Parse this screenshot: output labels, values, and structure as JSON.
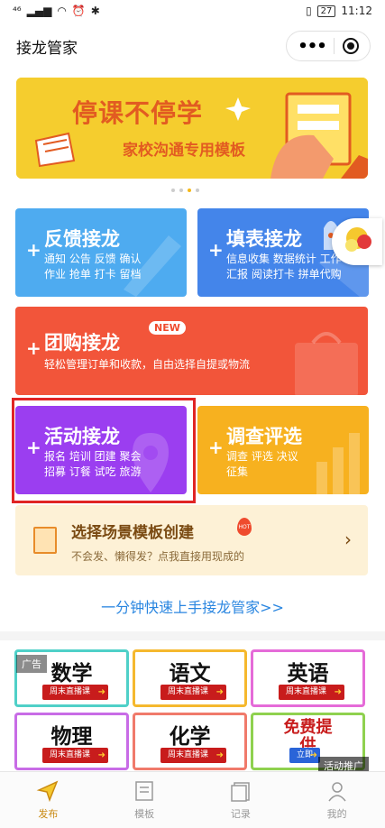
{
  "status": {
    "signal": "⁴⁶",
    "battery": "27",
    "time": "11:12"
  },
  "nav": {
    "title": "接龙管家"
  },
  "banner": {
    "title": "停课不停学",
    "subtitle": "家校沟通专用模板"
  },
  "cards": {
    "feedback": {
      "title": "反馈接龙",
      "sub1": "通知 公告 反馈 确认",
      "sub2": "作业 抢单 打卡 留档",
      "color": "#3fa6ee"
    },
    "form": {
      "title": "填表接龙",
      "sub1": "信息收集 数据统计 工作",
      "sub2": "汇报 阅读打卡 拼单代购",
      "color": "#3f7fe8"
    },
    "group": {
      "title": "团购接龙",
      "badge": "NEW",
      "sub1": "轻松管理订单和收款，自由选择自提或物流",
      "color": "#f2553a"
    },
    "activity": {
      "title": "活动接龙",
      "sub1": "报名 培训 团建 聚会",
      "sub2": "招募 订餐 试吃 旅游",
      "color": "#9b3ef0"
    },
    "survey": {
      "title": "调查评选",
      "sub1": "调查 评选 决议",
      "sub2": "征集",
      "color": "#f7b11f"
    }
  },
  "scene": {
    "title": "选择场景模板创建",
    "hot": "HOT",
    "subtitle": "不会发、懒得发？点我直接用现成的"
  },
  "quick_link": "一分钟快速上手接龙管家>>",
  "ad": {
    "label": "广告",
    "promo": "活动推广",
    "tiles": [
      {
        "subject": "数学",
        "pill": "周末直播课"
      },
      {
        "subject": "语文",
        "pill": "周末直播课"
      },
      {
        "subject": "英语",
        "pill": "周末直播课"
      },
      {
        "subject": "物理",
        "pill": "周末直播课"
      },
      {
        "subject": "化学",
        "pill": "周末直播课"
      },
      {
        "subject": "免费提供",
        "pill": "立即"
      }
    ]
  },
  "tabs": [
    {
      "label": "发布",
      "icon": "send-icon"
    },
    {
      "label": "模板",
      "icon": "template-icon"
    },
    {
      "label": "记录",
      "icon": "record-icon"
    },
    {
      "label": "我的",
      "icon": "profile-icon"
    }
  ]
}
